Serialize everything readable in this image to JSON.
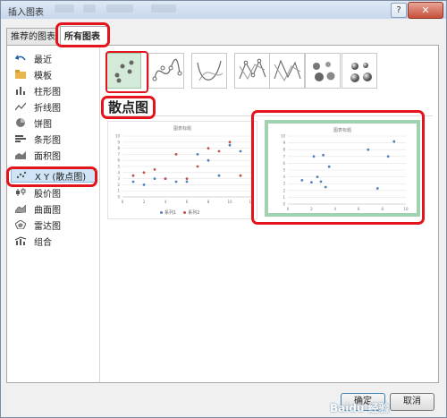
{
  "window": {
    "title": "插入图表",
    "help_label": "?",
    "close_label": "✕"
  },
  "tabs": [
    {
      "label": "推荐的图表"
    },
    {
      "label": "所有图表"
    }
  ],
  "sidebar": {
    "items": [
      {
        "label": "最近",
        "icon": "undo-icon"
      },
      {
        "label": "模板",
        "icon": "folder-icon"
      },
      {
        "label": "柱形图",
        "icon": "column-chart-icon"
      },
      {
        "label": "折线图",
        "icon": "line-chart-icon"
      },
      {
        "label": "饼图",
        "icon": "pie-chart-icon"
      },
      {
        "label": "条形图",
        "icon": "bar-chart-icon"
      },
      {
        "label": "面积图",
        "icon": "area-chart-icon"
      },
      {
        "label": "X Y (散点图)",
        "icon": "scatter-chart-icon"
      },
      {
        "label": "股价图",
        "icon": "stock-chart-icon"
      },
      {
        "label": "曲面图",
        "icon": "surface-chart-icon"
      },
      {
        "label": "雷达图",
        "icon": "radar-chart-icon"
      },
      {
        "label": "组合",
        "icon": "combo-chart-icon"
      }
    ],
    "selected_index": 7
  },
  "section_title": "散点图",
  "subtypes": [
    "scatter-icon",
    "scatter-smooth-markers-icon",
    "scatter-smooth-icon",
    "scatter-straight-markers-icon",
    "scatter-straight-icon",
    "bubble-icon",
    "bubble-3d-icon"
  ],
  "previews": [
    {
      "title": "图表标题",
      "chart_data": {
        "type": "scatter",
        "title": "图表标题",
        "ylim": [
          0,
          10
        ],
        "xlim": [
          0,
          12
        ],
        "yticks": [
          "0",
          "1",
          "2",
          "3",
          "4",
          "5",
          "6",
          "7",
          "8",
          "9",
          "10"
        ],
        "xticks": [
          "0",
          "2",
          "4",
          "6",
          "8",
          "10",
          "12"
        ],
        "series": [
          {
            "name": "系列1",
            "color": "#4f81bd",
            "x": [
              1,
              2,
              3,
              4,
              5,
              6,
              7,
              8,
              9,
              10,
              11
            ],
            "y": [
              2.5,
              2,
              3,
              3,
              2.5,
              2.5,
              7,
              6,
              3.5,
              8.5,
              7.5
            ]
          },
          {
            "name": "系列2",
            "color": "#c0504d",
            "x": [
              1,
              2,
              3,
              4,
              5,
              6,
              7,
              8,
              9,
              10,
              11
            ],
            "y": [
              3.5,
              4,
              4.5,
              3,
              7,
              3,
              5,
              8,
              7.5,
              9,
              3.5
            ]
          }
        ]
      }
    },
    {
      "title": "图表标题",
      "chart_data": {
        "type": "scatter",
        "title": "图表标题",
        "ylim": [
          0,
          10
        ],
        "xlim": [
          0,
          10
        ],
        "yticks": [
          "0",
          "1",
          "2",
          "3",
          "4",
          "5",
          "6",
          "7",
          "8",
          "9",
          "10"
        ],
        "xticks": [
          "0",
          "2",
          "4",
          "6",
          "8",
          "10"
        ],
        "series": [
          {
            "name": "",
            "color": "#4f81bd",
            "x": [
              1.2,
              2.0,
              2.2,
              2.5,
              2.8,
              3.0,
              3.2,
              3.5,
              6.8,
              7.6,
              8.5,
              9.0
            ],
            "y": [
              3.5,
              3.2,
              7.0,
              4.0,
              3.3,
              7.2,
              2.5,
              5.5,
              8.0,
              2.3,
              7.0,
              9.2
            ]
          }
        ]
      }
    }
  ],
  "buttons": {
    "ok": "确定",
    "cancel": "取消"
  },
  "watermark": "Baidu 经验"
}
